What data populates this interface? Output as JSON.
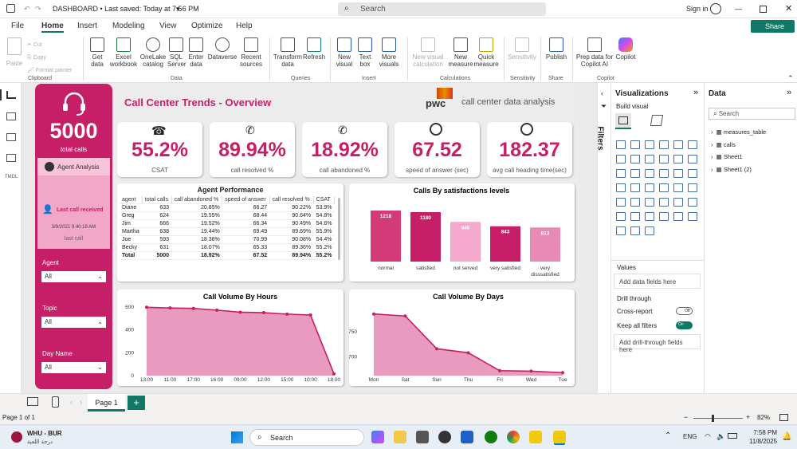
{
  "window": {
    "title": "DASHBOARD • Last saved: Today at 7:56 PM",
    "search_placeholder": "Search",
    "signin": "Sign in"
  },
  "menu": [
    "File",
    "Home",
    "Insert",
    "Modeling",
    "View",
    "Optimize",
    "Help"
  ],
  "share": "Share",
  "ribbon": {
    "clipboard": [
      "Paste",
      "Cut",
      "Copy",
      "Format painter"
    ],
    "groups": [
      "Clipboard",
      "Data",
      "Queries",
      "Insert",
      "Calculations",
      "Sensitivity",
      "Share",
      "Copilot"
    ],
    "buttons": [
      "Get data",
      "Excel workbook",
      "OneLake catalog",
      "SQL Server",
      "Enter data",
      "Dataverse",
      "Recent sources",
      "Transform data",
      "Refresh",
      "New visual",
      "Text box",
      "More visuals",
      "New visual calculation",
      "New measure",
      "Quick measure",
      "Sensitivity",
      "Publish",
      "Prep data for Copilot AI",
      "Copilot"
    ]
  },
  "report": {
    "title": "Call Center Trends - Overview",
    "brand": "pwc",
    "brand_sub": "call center data analysis",
    "total_calls": "5000",
    "total_calls_label": "total calls",
    "agent_analysis": "Agent Analysis",
    "last_call_label": "Last call received",
    "last_call_time": "3/9/2021 9:40:19 AM",
    "last_call_sub": "last call",
    "slicers": [
      {
        "label": "Agent",
        "value": "All"
      },
      {
        "label": "Topic",
        "value": "All"
      },
      {
        "label": "Day Name",
        "value": "All"
      }
    ],
    "kpis": [
      {
        "value": "55.2%",
        "label": "CSAT"
      },
      {
        "value": "89.94%",
        "label": "call resolved %"
      },
      {
        "value": "18.92%",
        "label": "call abandoned %"
      },
      {
        "value": "67.52",
        "label": "speed of answer (sec)"
      },
      {
        "value": "182.37",
        "label": "avg call heading time(sec)"
      }
    ],
    "table": {
      "title": "Agent Performance",
      "headers": [
        "agent",
        "total calls",
        "call abandoned %",
        "speed of answer",
        "call resolved %",
        "CSAT"
      ],
      "rows": [
        [
          "Diane",
          "633",
          "20.85%",
          "66.27",
          "90.22%",
          "53.9%"
        ],
        [
          "Greg",
          "624",
          "19.55%",
          "68.44",
          "90.64%",
          "54.8%"
        ],
        [
          "Jim",
          "666",
          "19.52%",
          "66.34",
          "90.49%",
          "54.6%"
        ],
        [
          "Martha",
          "638",
          "19.44%",
          "69.49",
          "89.69%",
          "55.9%"
        ],
        [
          "Joe",
          "593",
          "18.38%",
          "70.99",
          "90.08%",
          "54.4%"
        ],
        [
          "Becky",
          "631",
          "18.07%",
          "65.33",
          "89.36%",
          "55.2%"
        ]
      ],
      "total": [
        "Total",
        "5000",
        "18.92%",
        "67.52",
        "89.94%",
        "55.2%"
      ]
    }
  },
  "chart_data": [
    {
      "type": "bar",
      "title": "Calls By satisfactions levels",
      "categories": [
        "normal",
        "satisfied",
        "not served",
        "very satisfied",
        "very dissatisfied"
      ],
      "values": [
        1218,
        1180,
        946,
        843,
        813
      ],
      "colors": [
        "#d33a78",
        "#c71f67",
        "#f5a9cc",
        "#c71f67",
        "#e88ab5"
      ]
    },
    {
      "type": "area",
      "title": "Call Volume By Hours",
      "categories": [
        "13:00",
        "11:00",
        "17:00",
        "16:00",
        "09:00",
        "12:00",
        "15:00",
        "10:00",
        "18:00"
      ],
      "values": [
        598,
        592,
        588,
        573,
        555,
        551,
        538,
        530,
        16
      ],
      "ylim": [
        0,
        600
      ],
      "yticks": [
        "0",
        "200",
        "400",
        "600"
      ]
    },
    {
      "type": "area",
      "title": "Call Volume By Days",
      "categories": [
        "Mon",
        "Sat",
        "Sun",
        "Thu",
        "Fri",
        "Wed",
        "Tue"
      ],
      "values": [
        786,
        782,
        716,
        708,
        672,
        671,
        668
      ],
      "ylim": [
        662,
        800
      ],
      "yticks": [
        "700",
        "750"
      ]
    }
  ],
  "filters_label": "Filters",
  "viz": {
    "title": "Visualizations",
    "build": "Build visual",
    "values": "Values",
    "values_ph": "Add data fields here",
    "drill": "Drill through",
    "cross": "Cross-report",
    "cross_state": "Off",
    "keep": "Keep all filters",
    "keep_state": "On",
    "drill_ph": "Add drill-through fields here"
  },
  "data_pane": {
    "title": "Data",
    "search": "Search",
    "items": [
      "measures_table",
      "calls",
      "Sheet1",
      "Sheet1 (2)"
    ]
  },
  "page_tab": "Page 1",
  "status": {
    "page": "Page 1 of 1",
    "zoom": "82%"
  },
  "taskbar": {
    "weather": "WHU - BUR",
    "weather_sub": "درجة اللعبة",
    "search": "Search",
    "lang": "ENG",
    "time": "7:58 PM",
    "date": "11/8/2025"
  }
}
